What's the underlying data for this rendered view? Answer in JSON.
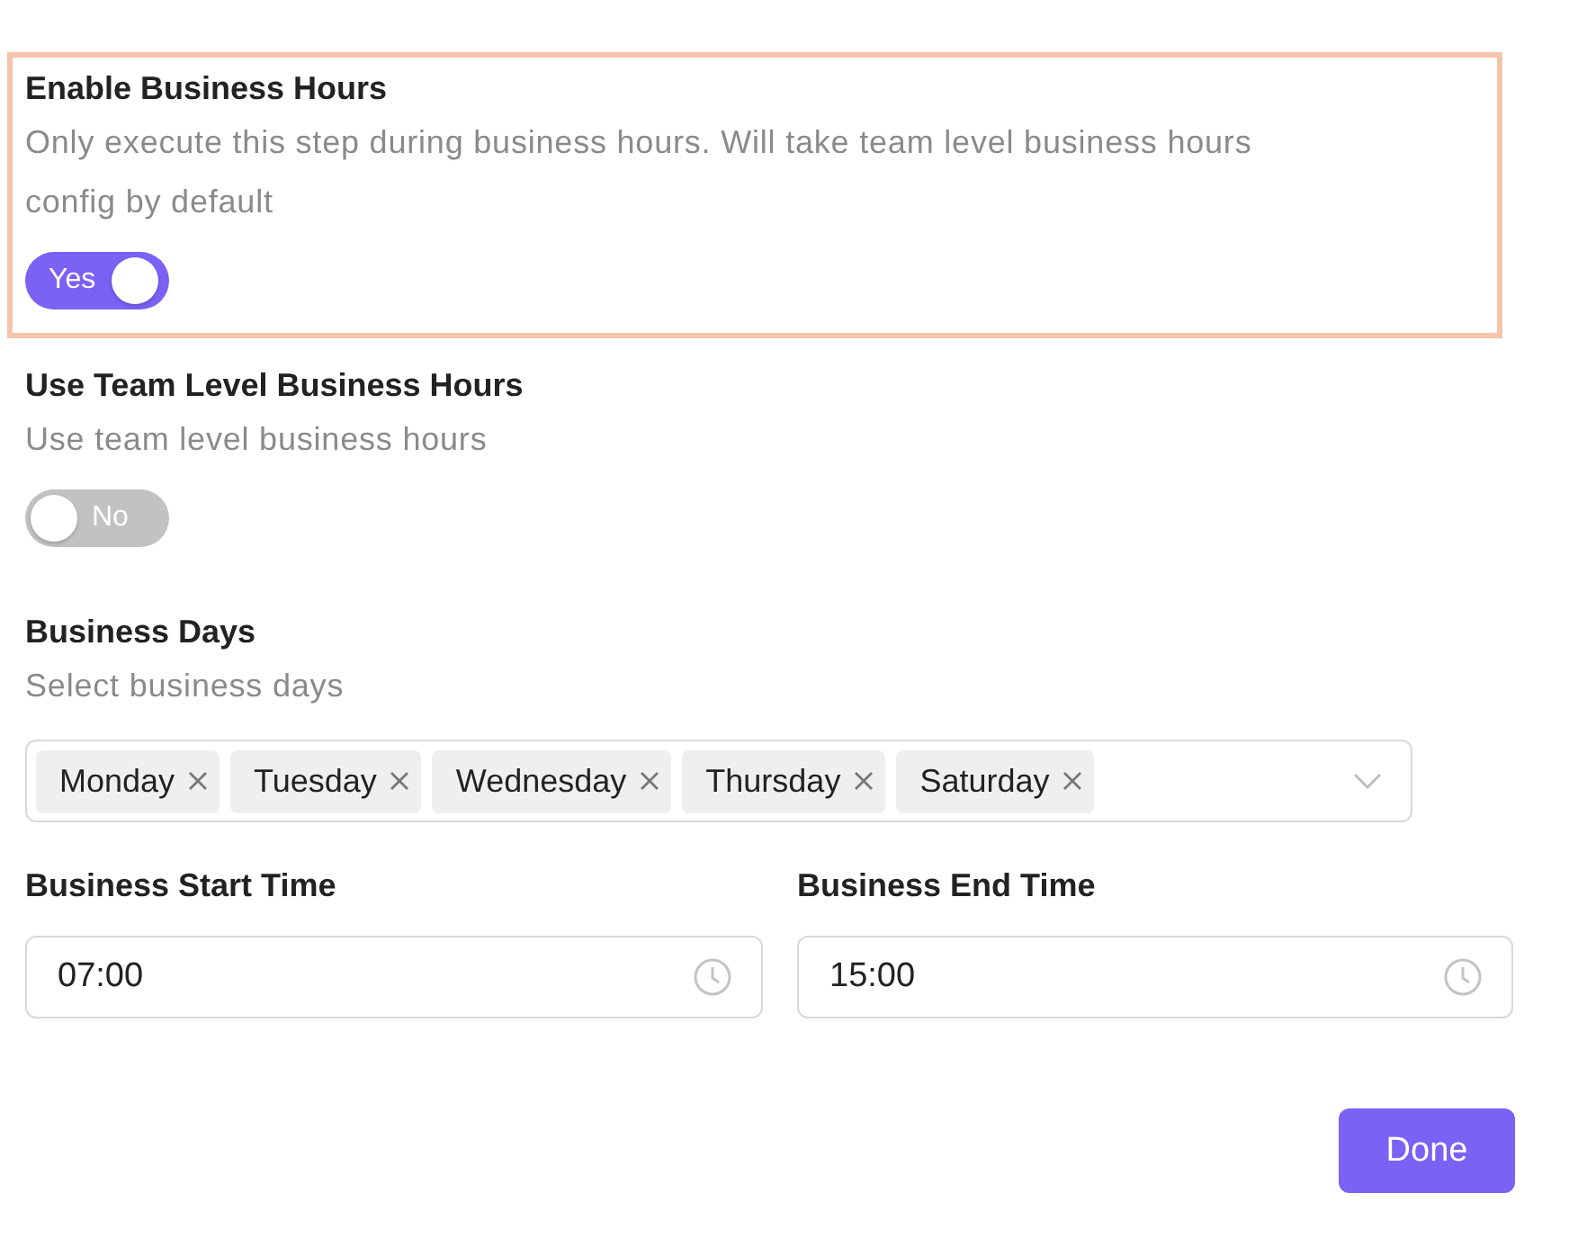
{
  "settings": [
    {
      "title": "Enable Business Hours",
      "description": "Only execute this step during business hours. Will take team level business hours config by default",
      "toggle": {
        "label": "Yes",
        "on": true
      },
      "highlighted": true
    },
    {
      "title": "Use Team Level Business Hours",
      "description": "Use team level business hours",
      "toggle": {
        "label": "No",
        "on": false
      },
      "highlighted": false
    }
  ],
  "business_days": {
    "title": "Business Days",
    "description": "Select business days",
    "tags": [
      "Monday",
      "Tuesday",
      "Wednesday",
      "Thursday",
      "Saturday"
    ]
  },
  "times": [
    {
      "label": "Business Start Time",
      "value": "07:00"
    },
    {
      "label": "Business End Time",
      "value": "15:00"
    }
  ],
  "done_button": "Done"
}
